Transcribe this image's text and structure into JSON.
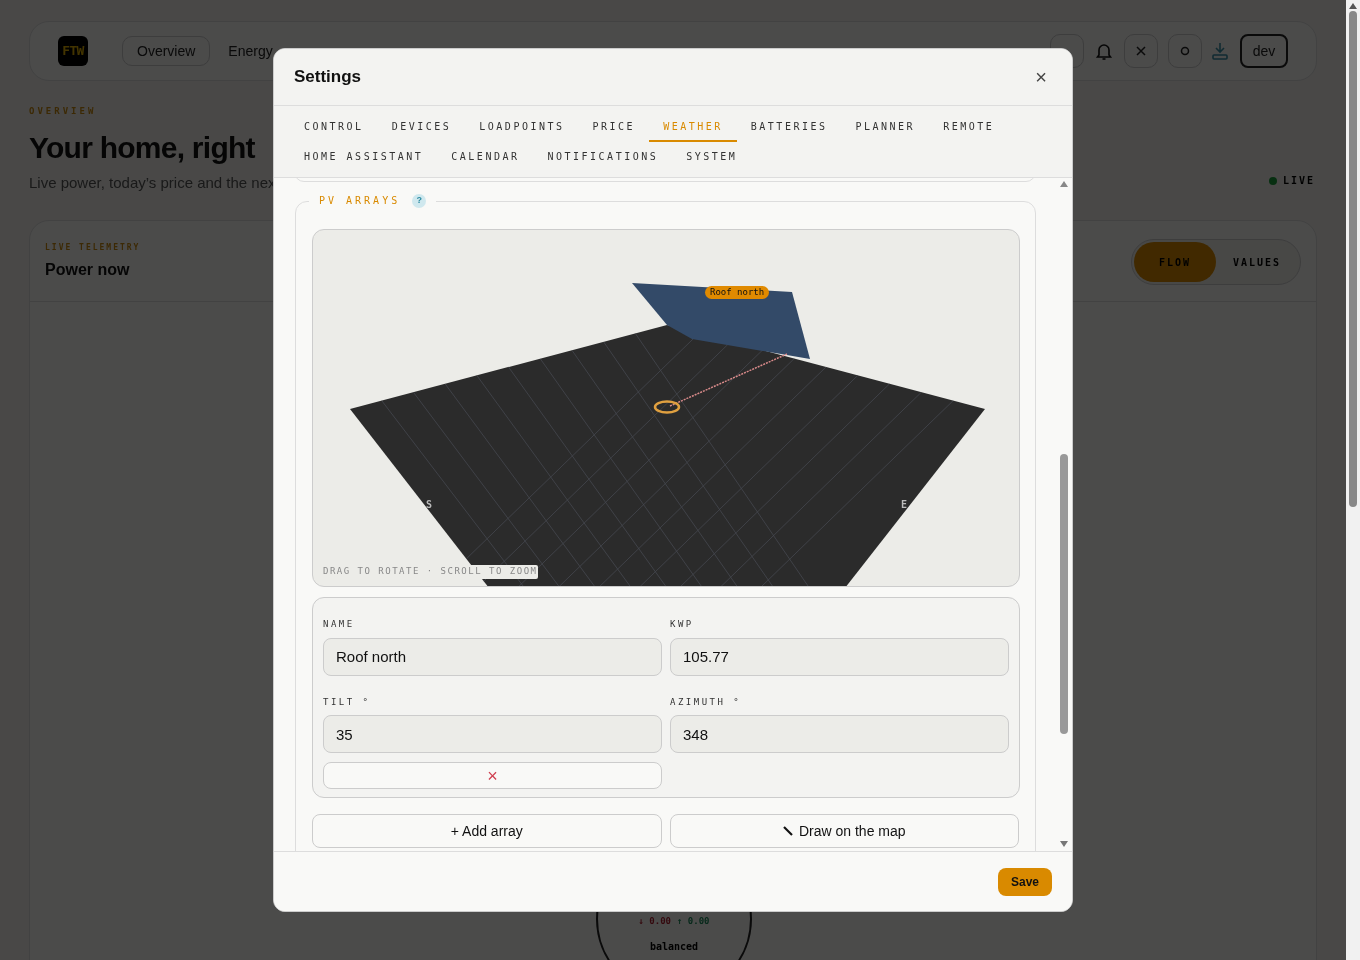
{
  "app": {
    "logo": "FTW",
    "nav": [
      {
        "label": "Overview",
        "selected": true
      },
      {
        "label": "Energy",
        "selected": false
      }
    ],
    "user": "dev"
  },
  "page": {
    "eyebrow": "OVERVIEW",
    "title": "Your home, right",
    "subtitle": "Live power, today’s price and the nex",
    "status": "LIVE"
  },
  "card": {
    "eyebrow": "LIVE TELEMETRY",
    "title": "Power now",
    "view_toggle": [
      {
        "label": "FLOW",
        "selected": true
      },
      {
        "label": "VALUES",
        "selected": false
      }
    ],
    "grid": {
      "import": "↓ 0.00",
      "export": "↑ 0.00",
      "state": "balanced"
    }
  },
  "dialog": {
    "title": "Settings",
    "close": "×",
    "tabs": [
      [
        {
          "label": "CONTROL",
          "selected": false
        },
        {
          "label": "DEVICES",
          "selected": false
        },
        {
          "label": "LOADPOINTS",
          "selected": false
        },
        {
          "label": "PRICE",
          "selected": false
        },
        {
          "label": "WEATHER",
          "selected": true
        },
        {
          "label": "BATTERIES",
          "selected": false
        },
        {
          "label": "PLANNER",
          "selected": false
        },
        {
          "label": "REMOTE",
          "selected": false
        }
      ],
      [
        {
          "label": "HOME ASSISTANT",
          "selected": false
        },
        {
          "label": "CALENDAR",
          "selected": false
        },
        {
          "label": "NOTIFICATIONS",
          "selected": false
        },
        {
          "label": "SYSTEM",
          "selected": false
        }
      ]
    ],
    "section": {
      "title": "PV ARRAYS",
      "help": "?",
      "scene": {
        "array_label": "Roof north",
        "compass": [
          "S",
          "E"
        ],
        "hint": "DRAG TO ROTATE · SCROLL TO ZOOM"
      },
      "arrays": [
        {
          "fields": [
            {
              "label": "NAME",
              "value": "Roof north"
            },
            {
              "label": "KWP",
              "value": "105.77"
            },
            {
              "label": "TILT °",
              "value": "35"
            },
            {
              "label": "AZIMUTH °",
              "value": "348"
            }
          ],
          "remove": "×"
        }
      ],
      "add": "+ Add array",
      "draw": "Draw on the map"
    },
    "save": "Save"
  }
}
